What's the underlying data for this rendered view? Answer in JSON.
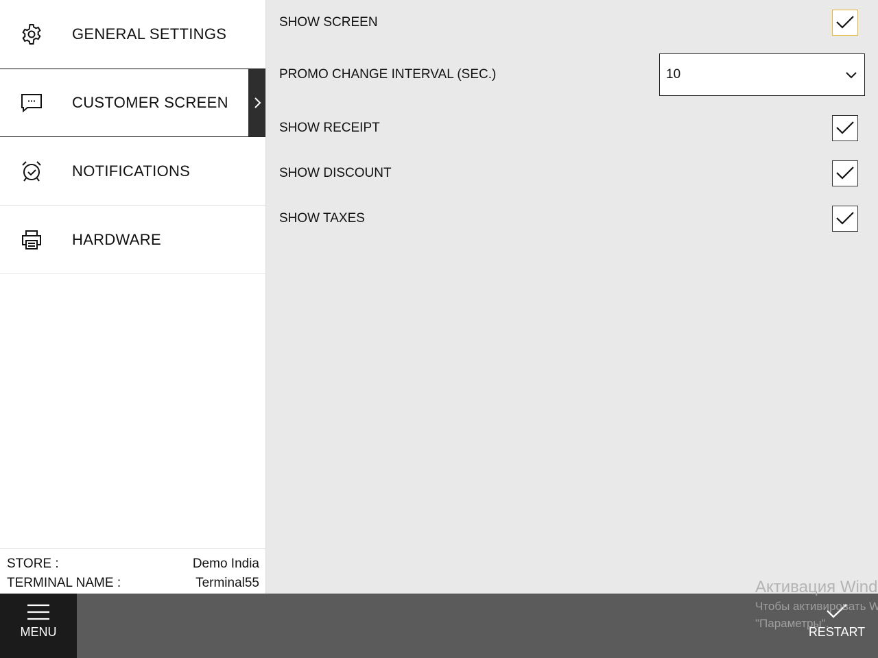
{
  "sidebar": {
    "items": [
      {
        "label": "GENERAL SETTINGS",
        "icon": "gear-icon"
      },
      {
        "label": "CUSTOMER SCREEN",
        "icon": "message-icon"
      },
      {
        "label": "NOTIFICATIONS",
        "icon": "alarm-clock-icon"
      },
      {
        "label": "HARDWARE",
        "icon": "printer-icon"
      }
    ],
    "active_index": 1,
    "store": {
      "label": "STORE :",
      "value": "Demo India"
    },
    "terminal": {
      "label": "TERMINAL NAME :",
      "value": "Terminal55"
    }
  },
  "settings": {
    "show_screen": {
      "label": "SHOW SCREEN",
      "checked": true
    },
    "promo_interval": {
      "label": "PROMO CHANGE INTERVAL (SEC.)",
      "value": "10"
    },
    "show_receipt": {
      "label": "SHOW RECEIPT",
      "checked": true
    },
    "show_discount": {
      "label": "SHOW DISCOUNT",
      "checked": true
    },
    "show_taxes": {
      "label": "SHOW TAXES",
      "checked": true
    }
  },
  "bottombar": {
    "menu_label": "MENU",
    "restart_label": "RESTART"
  },
  "watermark": {
    "title": "Активация Windows",
    "line1": "Чтобы активировать Windows,",
    "line2": "\"Параметры\"."
  },
  "colors": {
    "sidebar_bg": "#ffffff",
    "content_bg": "#e9e9e9",
    "bottombar_bg": "#5b5b5b",
    "menu_bg": "#1b1b1b",
    "active_marker": "#2e2e2e",
    "focus_border": "#e7b42a"
  }
}
